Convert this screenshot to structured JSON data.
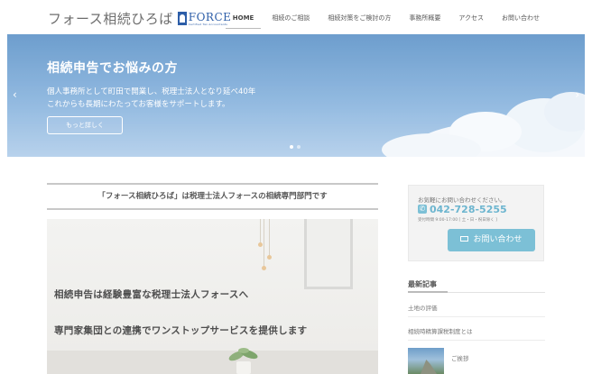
{
  "header": {
    "logo_text": "フォース相続ひろば",
    "logo_brand": "FORCE",
    "logo_brand_sub": "Certified Tax Accountants",
    "nav": [
      {
        "label": "HOME",
        "active": true
      },
      {
        "label": "相続のご相談",
        "active": false
      },
      {
        "label": "相続対策をご検討の方",
        "active": false
      },
      {
        "label": "事務所概要",
        "active": false
      },
      {
        "label": "アクセス",
        "active": false
      },
      {
        "label": "お問い合わせ",
        "active": false
      }
    ]
  },
  "hero": {
    "title": "相続申告でお悩みの方",
    "line1": "個人事務所として町田で開業し、税理士法人となり延べ40年",
    "line2": "これからも長期にわたってお客様をサポートします。",
    "button": "もっと詳しく",
    "prev_icon": "chevron-left-icon",
    "next_icon": "chevron-right-icon",
    "prev_glyph": "‹",
    "next_glyph": "›",
    "slides": 2,
    "current_slide": 1
  },
  "main": {
    "tagline": "「フォース相続ひろば」は税理士法人フォースの相続専門部門です",
    "feature_line1": "相続申告は経験豊富な税理士法人フォースへ",
    "feature_line2": "専門家集団との連携でワンストップサービスを提供します"
  },
  "sidebar": {
    "contact": {
      "prompt": "お気軽にお問い合わせください。",
      "phone": "042-728-5255",
      "hours": "受付時間 9:00-17:00 [ 土・日・祝日除く ]",
      "button": "お問い合わせ",
      "phone_icon": "phone-icon",
      "mail_icon": "mail-icon",
      "accent_color": "#7cc0d6"
    },
    "recent_heading": "最新記事",
    "recent_items": [
      "土地の評価",
      "相続時精算課税制度とは"
    ],
    "thumb_post_title": "ご挨拶"
  }
}
